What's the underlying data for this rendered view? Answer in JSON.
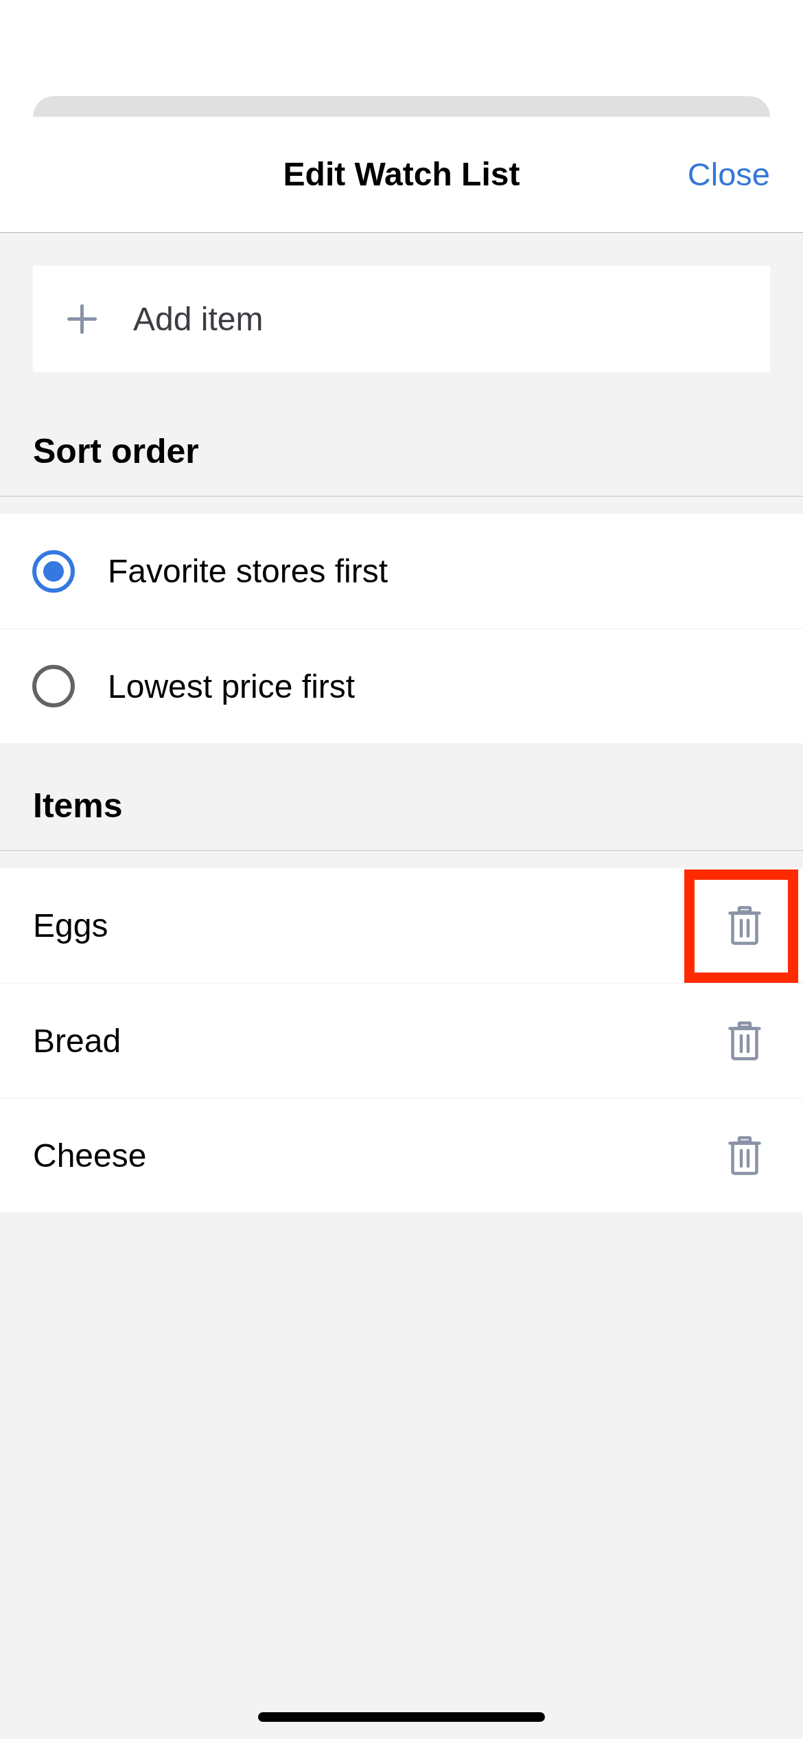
{
  "header": {
    "title": "Edit Watch List",
    "close_label": "Close"
  },
  "add_item": {
    "label": "Add item"
  },
  "sort_order": {
    "heading": "Sort order",
    "options": [
      {
        "label": "Favorite stores first",
        "selected": true
      },
      {
        "label": "Lowest price first",
        "selected": false
      }
    ]
  },
  "items_section": {
    "heading": "Items",
    "items": [
      {
        "name": "Eggs",
        "highlighted": true
      },
      {
        "name": "Bread",
        "highlighted": false
      },
      {
        "name": "Cheese",
        "highlighted": false
      }
    ]
  }
}
